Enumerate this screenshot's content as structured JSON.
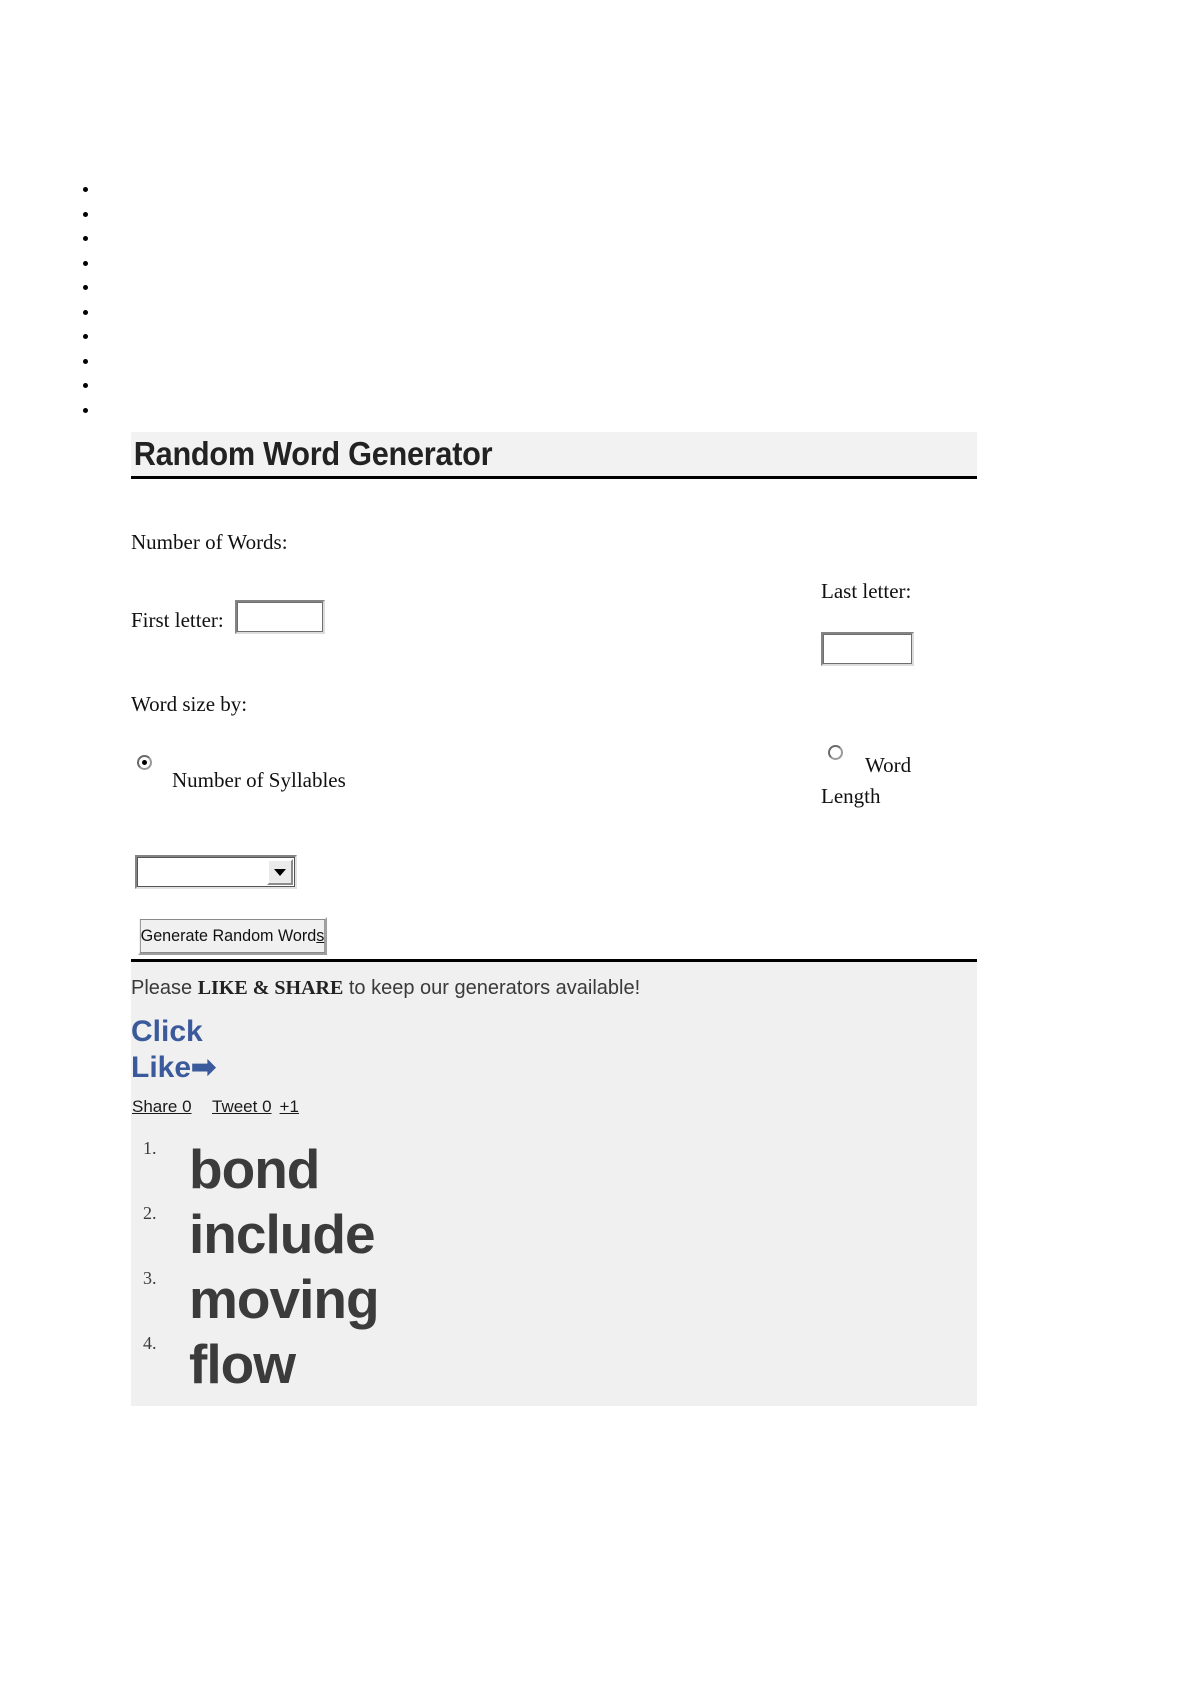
{
  "nav": {
    "items": [
      {
        "label": ""
      },
      {
        "label": ""
      },
      {
        "label": ""
      },
      {
        "label": ""
      },
      {
        "label": ""
      },
      {
        "label": ""
      },
      {
        "label": ""
      },
      {
        "label": ""
      },
      {
        "label": ""
      },
      {
        "label": ""
      }
    ]
  },
  "header": {
    "title": "Random Word Generator"
  },
  "form": {
    "number_of_words_label": "Number of Words:",
    "first_letter_label": "First letter:",
    "first_letter_value": "",
    "last_letter_label": "Last letter:",
    "last_letter_value": "",
    "word_size_by_label": "Word size by:",
    "syllables_label": "Number of Syllables",
    "syllables_selected": true,
    "word_length_label": "Word Length",
    "word_length_selected": false,
    "size_select_value": "",
    "size_select_options": [],
    "generate_button_label": "Generate Random Word",
    "generate_button_accesskey": "s"
  },
  "promo": {
    "please_text": "Please ",
    "like_share_text": "LIKE & SHARE",
    "tail_text": " to keep our generators available!",
    "click_like_line1": "Click",
    "click_like_line2": "Like",
    "arrow_glyph": "➡",
    "accent_color": "#3b5a9c"
  },
  "share": {
    "facebook_label": "Share 0",
    "twitter_label": "Tweet 0",
    "gplus_label": "+1"
  },
  "results": {
    "words": [
      "bond",
      "include",
      "moving",
      "flow"
    ]
  }
}
